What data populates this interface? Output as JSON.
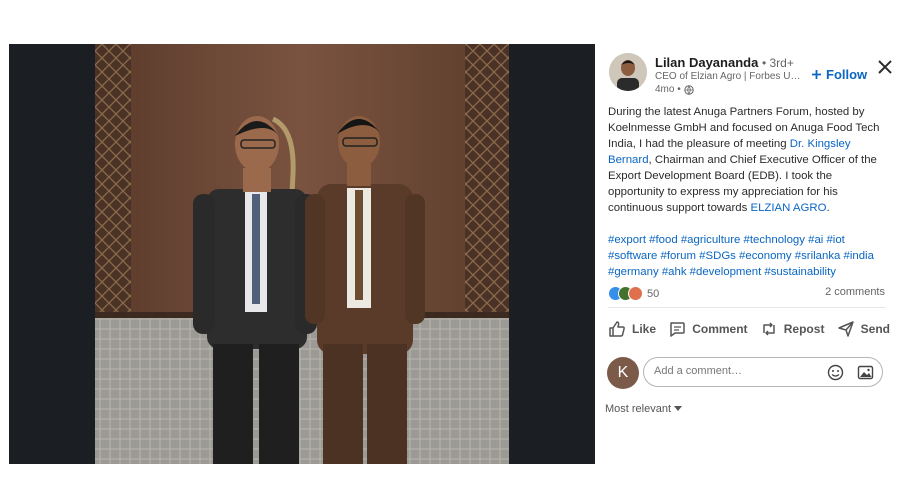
{
  "author": {
    "name": "Lilan Dayananda",
    "degree": "• 3rd+",
    "headline": "CEO of Elzian Agro | Forbes Unde...",
    "time": "4mo •",
    "follow_label": "Follow"
  },
  "post": {
    "text_parts": {
      "p1": "During the latest Anuga Partners Forum, hosted by Koelnmesse GmbH and focused on Anuga Food Tech India, I had the pleasure of meeting ",
      "mention1": "Dr. Kingsley Bernard",
      "p2": ", Chairman and Chief Executive Officer of the Export Development Board (EDB). I took the opportunity to express my appreciation for his continuous support towards ",
      "mention2": "ELZIAN AGRO",
      "p3": "."
    },
    "hashtags": "#export #food #agriculture #technology #ai #iot #software #forum #SDGs #economy #srilanka #india #germany #ahk #development #sustainability"
  },
  "social": {
    "reaction_count": "50",
    "comments_count": "2 comments",
    "reaction_colors": [
      "#378fe9",
      "#44712e",
      "#df704d"
    ]
  },
  "actions": {
    "like": "Like",
    "comment": "Comment",
    "repost": "Repost",
    "send": "Send"
  },
  "composer": {
    "avatar_letter": "K",
    "placeholder": "Add a comment…"
  },
  "sort": {
    "label": "Most relevant"
  },
  "colors": {
    "accent": "#0a66c2",
    "viewer_bg": "#1b1f23"
  }
}
